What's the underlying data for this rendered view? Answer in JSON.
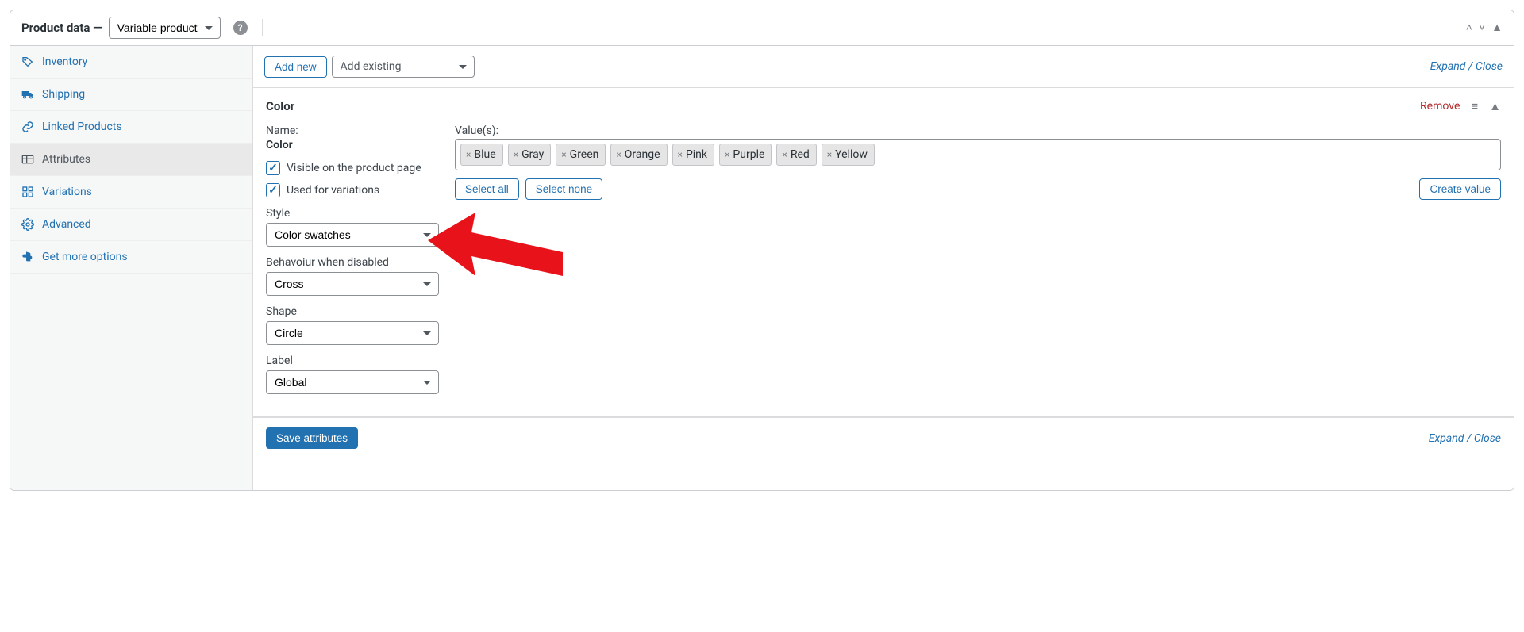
{
  "header": {
    "title_prefix": "Product data —",
    "product_type": "Variable product"
  },
  "tabs": {
    "inventory": "Inventory",
    "shipping": "Shipping",
    "linked": "Linked Products",
    "attributes": "Attributes",
    "variations": "Variations",
    "advanced": "Advanced",
    "more": "Get more options"
  },
  "toolbar": {
    "add_new": "Add new",
    "add_existing": "Add existing",
    "expand_close": "Expand / Close"
  },
  "attribute": {
    "title": "Color",
    "remove": "Remove",
    "name_label": "Name:",
    "name_value": "Color",
    "visible_label": "Visible on the product page",
    "used_var_label": "Used for variations",
    "style_label": "Style",
    "style_value": "Color swatches",
    "behaviour_label": "Behavoiur when disabled",
    "behaviour_value": "Cross",
    "shape_label": "Shape",
    "shape_value": "Circle",
    "label_label": "Label",
    "label_value": "Global",
    "values_label": "Value(s):",
    "values": [
      "Blue",
      "Gray",
      "Green",
      "Orange",
      "Pink",
      "Purple",
      "Red",
      "Yellow"
    ],
    "select_all": "Select all",
    "select_none": "Select none",
    "create_value": "Create value"
  },
  "footer": {
    "save": "Save attributes",
    "expand_close": "Expand / Close"
  }
}
